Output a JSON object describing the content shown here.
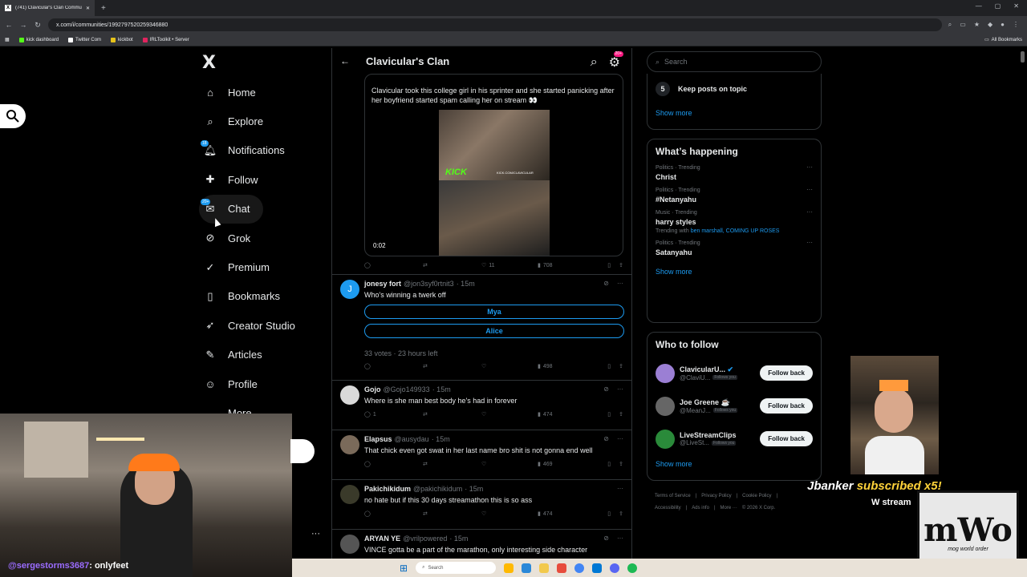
{
  "browser": {
    "tab_title": "(741) Clavicular's Clan Communi",
    "url": "x.com/i/communities/1992797520259346880",
    "bookmarks": [
      {
        "label": "kick dashboard",
        "color": "#53fc18"
      },
      {
        "label": "Twitter Com",
        "color": "#ffffff"
      },
      {
        "label": "kickbot",
        "color": "#e6c21a"
      },
      {
        "label": "IRLToolkit • Server",
        "color": "#e0245e"
      }
    ],
    "all_bookmarks": "All Bookmarks"
  },
  "nav": {
    "logo": "X",
    "items": [
      {
        "label": "Home",
        "icon": "home-icon",
        "glyph": "⌂"
      },
      {
        "label": "Explore",
        "icon": "search-icon",
        "glyph": "⌕"
      },
      {
        "label": "Notifications",
        "icon": "bell-icon",
        "glyph": "♫",
        "badge": "18"
      },
      {
        "label": "Follow",
        "icon": "follow-icon",
        "glyph": "✚"
      },
      {
        "label": "Chat",
        "icon": "chat-icon",
        "glyph": "✉",
        "badge": "20+"
      },
      {
        "label": "Grok",
        "icon": "grok-icon",
        "glyph": "⊘"
      },
      {
        "label": "Premium",
        "icon": "premium-icon",
        "glyph": "✓"
      },
      {
        "label": "Bookmarks",
        "icon": "bookmark-icon",
        "glyph": "▯"
      },
      {
        "label": "Creator Studio",
        "icon": "rocket-icon",
        "glyph": "➶"
      },
      {
        "label": "Articles",
        "icon": "articles-icon",
        "glyph": "✎"
      },
      {
        "label": "Profile",
        "icon": "profile-icon",
        "glyph": "☺"
      },
      {
        "label": "More",
        "icon": "more-icon",
        "glyph": "…"
      }
    ]
  },
  "main": {
    "title": "Clavicular's Clan",
    "header_badge": "20+",
    "quoted": {
      "text": "Clavicular took this college girl in his sprinter and she started panicking after her boyfriend started spam calling her on stream 👀",
      "video_time": "0:02",
      "kick_label": "KICK",
      "kick_url": "KICK.COM/CLAVICULAR"
    },
    "quoted_actions": {
      "reply": "",
      "repost": "",
      "like": "11",
      "views": "708"
    },
    "tweets": [
      {
        "name": "jonesy fort",
        "handle": "@jon3syf0rtnit3",
        "time": "· 15m",
        "avatar": "J",
        "avatar_color": "#1d9bf0",
        "text": "Who's winning a twerk off",
        "poll": [
          "Mya",
          "Alice"
        ],
        "poll_meta": "33 votes · 23 hours left",
        "reply": "",
        "repost": "",
        "like": "",
        "views": "498"
      },
      {
        "name": "Gojo",
        "handle": "@Gojo149933",
        "time": "· 15m",
        "avatar": "",
        "avatar_color": "#d9d9d9",
        "text": "Where is she man best body he's had in forever",
        "reply": "1",
        "repost": "",
        "like": "",
        "views": "474"
      },
      {
        "name": "Elapsus",
        "handle": "@ausydau",
        "time": "· 15m",
        "avatar": "",
        "avatar_color": "#7a6a5a",
        "text": "That chick even got swat in her last name bro shit is not gonna end well",
        "reply": "",
        "repost": "",
        "like": "",
        "views": "469"
      },
      {
        "name": "Pakichikidum",
        "handle": "@pakichikidum",
        "time": "· 15m",
        "avatar": "",
        "avatar_color": "#3a3a2a",
        "text": "no hate but if this 30 days streamathon this is so ass",
        "reply": "",
        "repost": "",
        "like": "",
        "views": "474"
      },
      {
        "name": "ARYAN YE",
        "handle": "@vrilpowered",
        "time": "· 15m",
        "avatar": "",
        "avatar_color": "#555555",
        "text": "VINCE gotta be a part of the marathon, only interesting side character",
        "reply": "",
        "repost": "",
        "like": "",
        "views": ""
      }
    ]
  },
  "sidebar": {
    "search_placeholder": "Search",
    "rule": {
      "num": "5",
      "text": "Keep posts on topic"
    },
    "show_more": "Show more",
    "happening_title": "What’s happening",
    "trends": [
      {
        "cat": "Politics · Trending",
        "name": "Christ",
        "with": ""
      },
      {
        "cat": "Politics · Trending",
        "name": "#Netanyahu",
        "with": ""
      },
      {
        "cat": "Music · Trending",
        "name": "harry styles",
        "with_prefix": "Trending with ",
        "with": "ben marshall, COMING UP ROSES"
      },
      {
        "cat": "Politics · Trending",
        "name": "Satanyahu",
        "with": ""
      }
    ],
    "who_title": "Who to follow",
    "follows": [
      {
        "name": "ClavicularU...",
        "handle": "@ClaviU...",
        "fy": "Follows you",
        "btn": "Follow back",
        "color": "#9b7fd4"
      },
      {
        "name": "Joe Greene ☕",
        "handle": "@MeanJ...",
        "fy": "Follows you",
        "btn": "Follow back",
        "color": "#666666"
      },
      {
        "name": "LiveStreamClips",
        "handle": "@LiveSt...",
        "fy": "Follows you",
        "btn": "Follow back",
        "color": "#2a8a3a"
      }
    ],
    "footer": [
      "Terms of Service",
      "|",
      "Privacy Policy",
      "|",
      "Cookie Policy",
      "|",
      "Accessibility",
      "|",
      "Ads info",
      "|",
      "More ···",
      "© 2026 X Corp."
    ]
  },
  "overlay": {
    "chat_user": "@sergestorms3687",
    "chat_msg": ": onlyfeet",
    "sub_name": "Jbanker",
    "sub_text": "subscribed x5!",
    "sub_msg": "W stream",
    "mwo_big": "mWo",
    "mwo_small": "mog world order"
  },
  "taskbar": {
    "search": "Search"
  }
}
